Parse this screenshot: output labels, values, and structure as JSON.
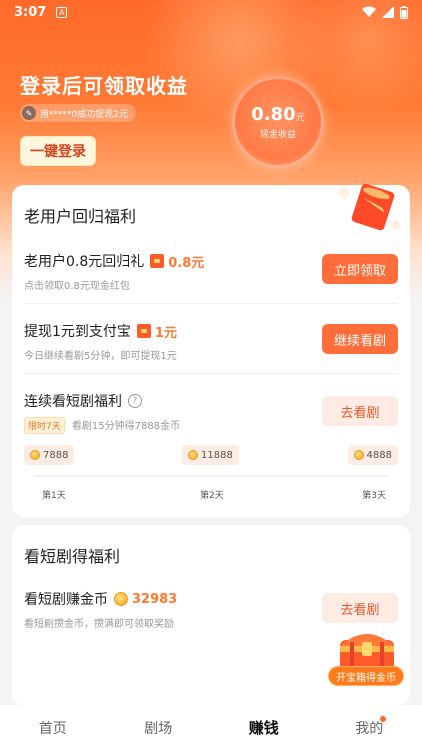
{
  "status": {
    "time": "3:07",
    "notif_icon": "A"
  },
  "hero": {
    "title": "登录后可领取收益",
    "notice": "用*****0成功提现2元",
    "login_label": "一键登录",
    "earn_amount": "0.80",
    "earn_unit": "元",
    "earn_label": "现金收益"
  },
  "card1": {
    "title": "老用户回归福利",
    "rows": [
      {
        "title": "老用户0.8元回归礼",
        "amount": "0.8元",
        "sub": "点击领取0.8元现金红包",
        "button": "立即领取"
      },
      {
        "title": "提现1元到支付宝",
        "amount": "1元",
        "sub": "今日继续看剧5分钟，即可提现1元",
        "button": "继续看剧"
      }
    ],
    "streak": {
      "title": "连续看短剧福利",
      "help": "?",
      "tag": "限时7天",
      "sub": "看剧15分钟得7888金币",
      "button": "去看剧",
      "days": [
        {
          "coins": "7888",
          "label": "第1天"
        },
        {
          "coins": "11888",
          "label": "第2天"
        },
        {
          "coins": "4888",
          "label": "第3天"
        }
      ]
    }
  },
  "card2": {
    "title": "看短剧得福利",
    "row": {
      "title": "看短剧赚金币",
      "amount": "32983",
      "sub": "看短剧攒金币，攒满即可领取奖励",
      "button": "去看剧"
    }
  },
  "treasure": {
    "label": "开宝箱得金币"
  },
  "tabs": [
    "首页",
    "剧场",
    "赚钱",
    "我的"
  ],
  "colors": {
    "accent": "#ff6a2a",
    "button": "#ff6e3a",
    "amount": "#ff7a30"
  }
}
